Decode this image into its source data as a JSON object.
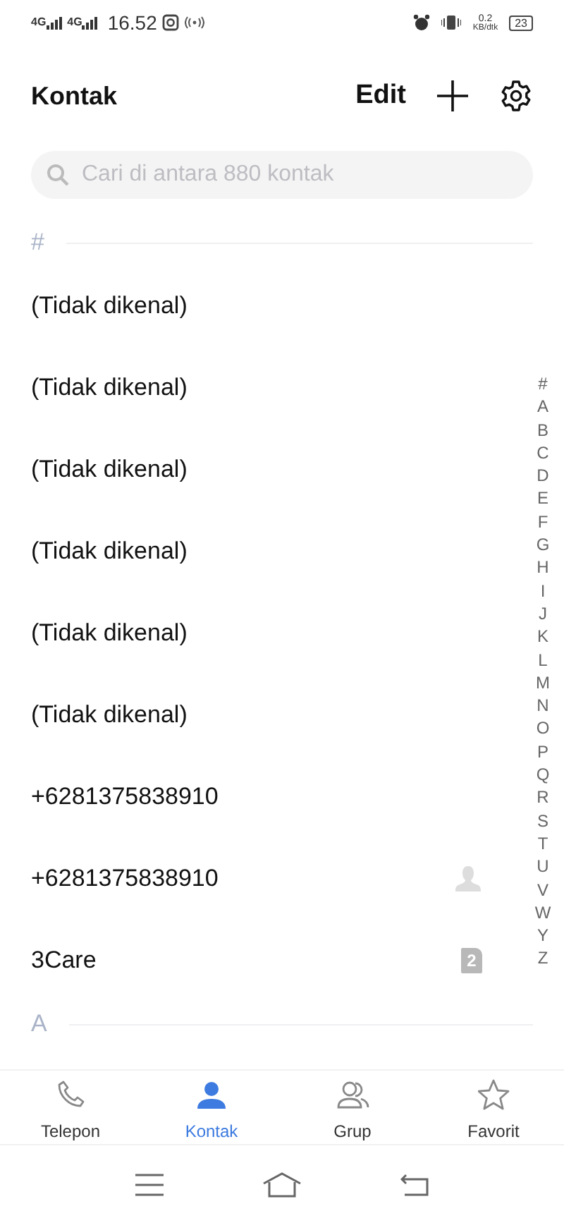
{
  "status_bar": {
    "sim_1": "4G",
    "sim_2": "4G",
    "time": "16.52",
    "speed": "0.2",
    "speed_unit": "KB/dtk",
    "battery": "23"
  },
  "header": {
    "title": "Kontak",
    "edit": "Edit"
  },
  "search": {
    "placeholder": "Cari di antara 880 kontak"
  },
  "sections": [
    {
      "letter": "#",
      "contacts": [
        {
          "name": "(Tidak dikenal)",
          "kind": "plain"
        },
        {
          "name": "(Tidak dikenal)",
          "kind": "plain"
        },
        {
          "name": "(Tidak dikenal)",
          "kind": "plain"
        },
        {
          "name": "(Tidak dikenal)",
          "kind": "plain"
        },
        {
          "name": "(Tidak dikenal)",
          "kind": "plain"
        },
        {
          "name": "(Tidak dikenal)",
          "kind": "plain"
        },
        {
          "name": "+6281375838910",
          "kind": "plain"
        },
        {
          "name": "+6281375838910",
          "kind": "account"
        },
        {
          "name": "3Care",
          "kind": "sim",
          "sim": "2"
        }
      ]
    },
    {
      "letter": "A"
    }
  ],
  "index": [
    "#",
    "A",
    "B",
    "C",
    "D",
    "E",
    "F",
    "G",
    "H",
    "I",
    "J",
    "K",
    "L",
    "M",
    "N",
    "O",
    "P",
    "Q",
    "R",
    "S",
    "T",
    "U",
    "V",
    "W",
    "Y",
    "Z"
  ],
  "tabs": [
    {
      "label": "Telepon",
      "kind": "phone",
      "selected": false
    },
    {
      "label": "Kontak",
      "kind": "person",
      "selected": true
    },
    {
      "label": "Grup",
      "kind": "group",
      "selected": false
    },
    {
      "label": "Favorit",
      "kind": "star",
      "selected": false
    }
  ]
}
